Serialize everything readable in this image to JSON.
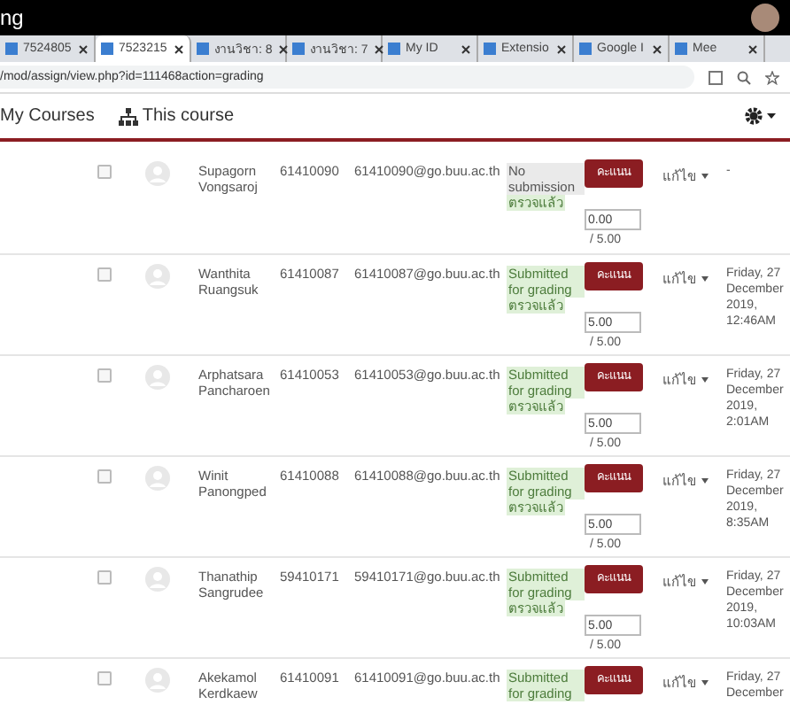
{
  "window": {
    "title": "ng"
  },
  "tabs": [
    {
      "label": "7524805",
      "selected": false
    },
    {
      "label": "7523215",
      "selected": true
    },
    {
      "label": "งานวิชา: 8",
      "selected": false
    },
    {
      "label": "งานวิชา: 7",
      "selected": false
    },
    {
      "label": "My ID",
      "selected": false
    },
    {
      "label": "Extensio",
      "selected": false
    },
    {
      "label": "Google I",
      "selected": false
    },
    {
      "label": "Mee",
      "selected": false
    }
  ],
  "address_bar": {
    "url": "/mod/assign/view.php?id=111468action=grading"
  },
  "nav": {
    "items": [
      "My Courses",
      "This course"
    ]
  },
  "rows": [
    {
      "checked": false,
      "name": "Supagorn Vongsaroj",
      "id": "61410090",
      "email": "61410090@go.buu.ac.th",
      "status": [
        {
          "text": "No submission",
          "kind": "none"
        },
        {
          "text": "ตรวจแล้ว",
          "kind": "graded"
        }
      ],
      "button": "คะแนน",
      "edit": "แก้ไข",
      "grade": "0.00",
      "out_of": "/ 5.00",
      "date": "-"
    },
    {
      "checked": false,
      "name": "Wanthita Ruangsuk",
      "id": "61410087",
      "email": "61410087@go.buu.ac.th",
      "status": [
        {
          "text": "Submitted for grading",
          "kind": "submitted"
        },
        {
          "text": "ตรวจแล้ว",
          "kind": "graded"
        }
      ],
      "button": "คะแนน",
      "edit": "แก้ไข",
      "grade": "5.00",
      "out_of": "/ 5.00",
      "date": "Friday, 27 December 2019, 12:46AM"
    },
    {
      "checked": false,
      "name": "Arphatsara Pancharoen",
      "id": "61410053",
      "email": "61410053@go.buu.ac.th",
      "status": [
        {
          "text": "Submitted for grading",
          "kind": "submitted"
        },
        {
          "text": "ตรวจแล้ว",
          "kind": "graded"
        }
      ],
      "button": "คะแนน",
      "edit": "แก้ไข",
      "grade": "5.00",
      "out_of": "/ 5.00",
      "date": "Friday, 27 December 2019, 2:01AM"
    },
    {
      "checked": false,
      "name": "Winit Panongped",
      "id": "61410088",
      "email": "61410088@go.buu.ac.th",
      "status": [
        {
          "text": "Submitted for grading",
          "kind": "submitted"
        },
        {
          "text": "ตรวจแล้ว",
          "kind": "graded"
        }
      ],
      "button": "คะแนน",
      "edit": "แก้ไข",
      "grade": "5.00",
      "out_of": "/ 5.00",
      "date": "Friday, 27 December 2019, 8:35AM"
    },
    {
      "checked": false,
      "name": "Thanathip Sangrudee",
      "id": "59410171",
      "email": "59410171@go.buu.ac.th",
      "status": [
        {
          "text": "Submitted for grading",
          "kind": "submitted"
        },
        {
          "text": "ตรวจแล้ว",
          "kind": "graded"
        }
      ],
      "button": "คะแนน",
      "edit": "แก้ไข",
      "grade": "5.00",
      "out_of": "/ 5.00",
      "date": "Friday, 27 December 2019, 10:03AM"
    },
    {
      "checked": false,
      "name": "Akekamol Kerdkaew",
      "id": "61410091",
      "email": "61410091@go.buu.ac.th",
      "status": [
        {
          "text": "Submitted for grading",
          "kind": "submitted"
        }
      ],
      "button": "คะแนน",
      "edit": "แก้ไข",
      "date": "Friday, 27 December"
    }
  ]
}
